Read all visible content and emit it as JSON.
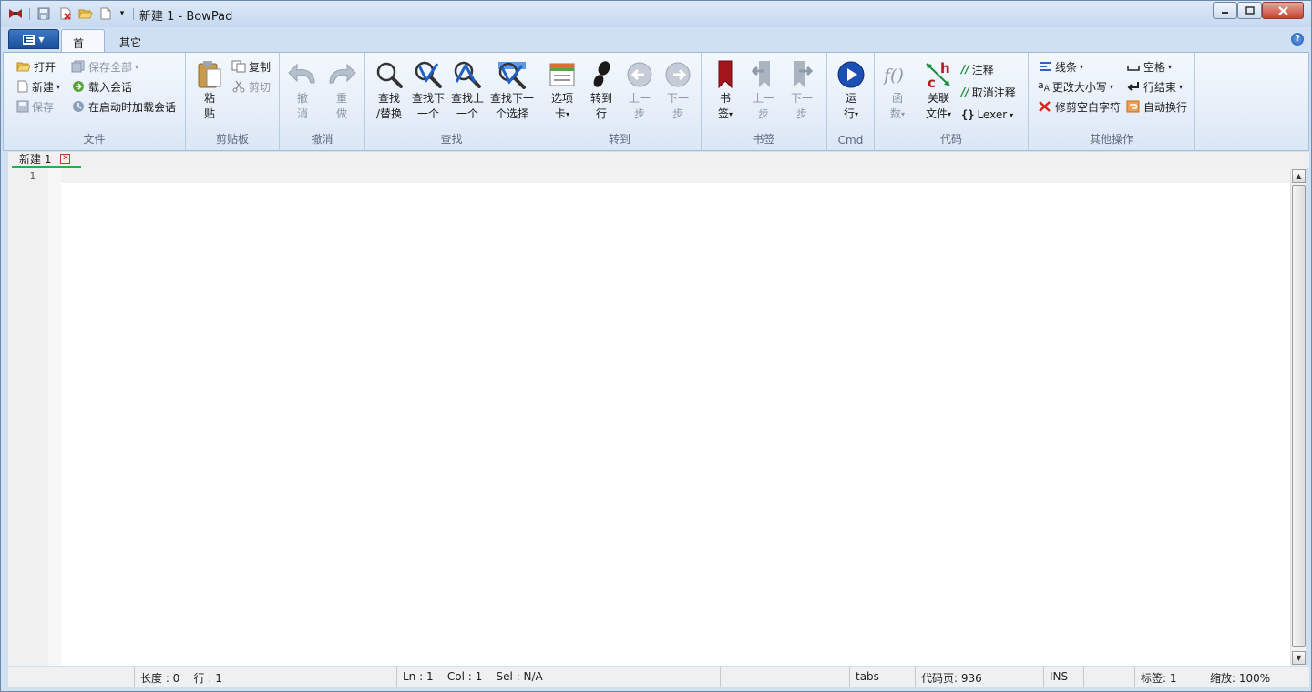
{
  "window": {
    "title": "新建 1 - BowPad"
  },
  "quick_access": {
    "icons": [
      "save-icon",
      "close-file-icon",
      "open-folder-icon",
      "new-file-icon",
      "customize-dropdown-icon"
    ]
  },
  "ribbon_tabs": [
    {
      "label": "首页",
      "active": true
    },
    {
      "label": "其它",
      "active": false
    }
  ],
  "groups": {
    "file": {
      "label": "文件",
      "open": "打开",
      "new": "新建",
      "save": "保存",
      "save_all": "保存全部",
      "load_session": "载入会话",
      "load_session_startup": "在启动时加载会话"
    },
    "clipboard": {
      "label": "剪贴板",
      "paste_l1": "粘",
      "paste_l2": "贴",
      "copy": "复制",
      "cut": "剪切"
    },
    "undo": {
      "label": "撤消",
      "undo_l1": "撤",
      "undo_l2": "消",
      "redo_l1": "重",
      "redo_l2": "做"
    },
    "find": {
      "label": "查找",
      "find_l1": "查找",
      "find_l2": "/替换",
      "next_l1": "查找下",
      "next_l2": "一个",
      "prev_l1": "查找上",
      "prev_l2": "一个",
      "sel_l1": "查找下一",
      "sel_l2": "个选择"
    },
    "goto": {
      "label": "转到",
      "tabs_l1": "选项",
      "tabs_l2": "卡",
      "line_l1": "转到",
      "line_l2": "行",
      "back_l1": "上一",
      "back_l2": "步",
      "fwd_l1": "下一",
      "fwd_l2": "步"
    },
    "bookmarks": {
      "label": "书签",
      "bm_l1": "书",
      "bm_l2": "签",
      "prev_l1": "上一",
      "prev_l2": "步",
      "next_l1": "下一",
      "next_l2": "步"
    },
    "cmd": {
      "label": "Cmd",
      "run_l1": "运",
      "run_l2": "行"
    },
    "code": {
      "label": "代码",
      "func_l1": "函",
      "func_l2": "数",
      "assoc_l1": "关联",
      "assoc_l2": "文件",
      "comment": "注释",
      "uncomment": "取消注释",
      "lexer": "Lexer"
    },
    "other": {
      "label": "其他操作",
      "lines": "线条",
      "case": "更改大小写",
      "trim": "修剪空白字符",
      "spaces": "空格",
      "eol": "行结束",
      "wrap": "自动换行"
    }
  },
  "doc_tab": {
    "label": "新建  1"
  },
  "editor": {
    "line_number": "1"
  },
  "status": {
    "length": "长度 : 0",
    "line": "行 : 1",
    "ln": "Ln : 1",
    "col": "Col : 1",
    "sel": "Sel : N/A",
    "tabs": "tabs",
    "codepage": "代码页: 936",
    "ins": "INS",
    "tabs_count": "标签: 1",
    "zoom": "缩放: 100%"
  }
}
